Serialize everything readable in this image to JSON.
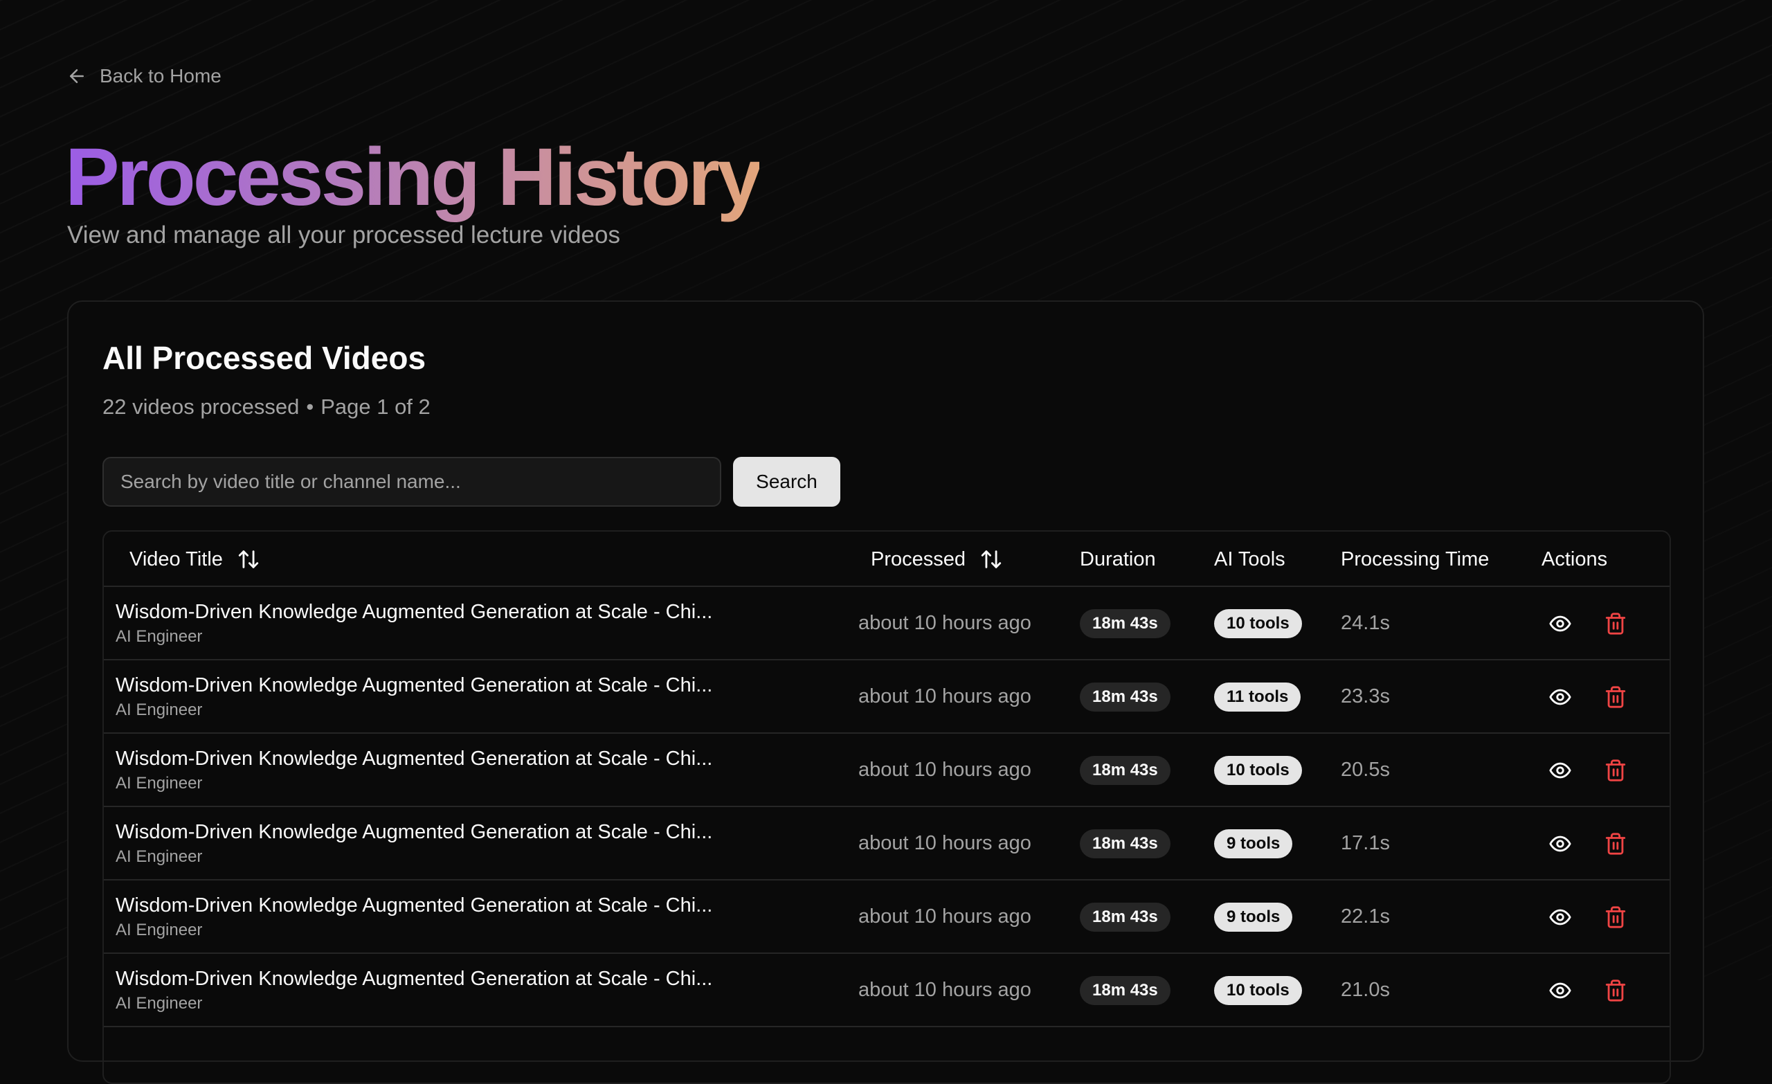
{
  "nav": {
    "back_label": "Back to Home"
  },
  "header": {
    "title": "Processing History",
    "subtitle": "View and manage all your processed lecture videos"
  },
  "card": {
    "title": "All Processed Videos",
    "count_text": "22 videos processed",
    "separator": "•",
    "page_text": "Page 1 of 2"
  },
  "search": {
    "placeholder": "Search by video title or channel name...",
    "value": "",
    "button_label": "Search"
  },
  "table": {
    "columns": {
      "title": "Video Title",
      "processed": "Processed",
      "duration": "Duration",
      "ai_tools": "AI Tools",
      "processing_time": "Processing Time",
      "actions": "Actions"
    },
    "rows": [
      {
        "title": "Wisdom-Driven Knowledge Augmented Generation at Scale - Chi...",
        "channel": "AI Engineer",
        "processed": "about 10 hours ago",
        "duration": "18m 43s",
        "tools": "10 tools",
        "time": "24.1s"
      },
      {
        "title": "Wisdom-Driven Knowledge Augmented Generation at Scale - Chi...",
        "channel": "AI Engineer",
        "processed": "about 10 hours ago",
        "duration": "18m 43s",
        "tools": "11 tools",
        "time": "23.3s"
      },
      {
        "title": "Wisdom-Driven Knowledge Augmented Generation at Scale - Chi...",
        "channel": "AI Engineer",
        "processed": "about 10 hours ago",
        "duration": "18m 43s",
        "tools": "10 tools",
        "time": "20.5s"
      },
      {
        "title": "Wisdom-Driven Knowledge Augmented Generation at Scale - Chi...",
        "channel": "AI Engineer",
        "processed": "about 10 hours ago",
        "duration": "18m 43s",
        "tools": "9 tools",
        "time": "17.1s"
      },
      {
        "title": "Wisdom-Driven Knowledge Augmented Generation at Scale - Chi...",
        "channel": "AI Engineer",
        "processed": "about 10 hours ago",
        "duration": "18m 43s",
        "tools": "9 tools",
        "time": "22.1s"
      },
      {
        "title": "Wisdom-Driven Knowledge Augmented Generation at Scale - Chi...",
        "channel": "AI Engineer",
        "processed": "about 10 hours ago",
        "duration": "18m 43s",
        "tools": "10 tools",
        "time": "21.0s"
      }
    ]
  },
  "icons": {
    "back": "arrow-left-icon",
    "sort": "arrow-up-down-icon",
    "view": "eye-icon",
    "delete": "trash-icon"
  },
  "colors": {
    "background": "#0a0a0a",
    "title_gradient_start": "#9b5de5",
    "title_gradient_end": "#e2a57b",
    "muted_text": "#a3a3a3",
    "delete_red": "#ef4444"
  }
}
